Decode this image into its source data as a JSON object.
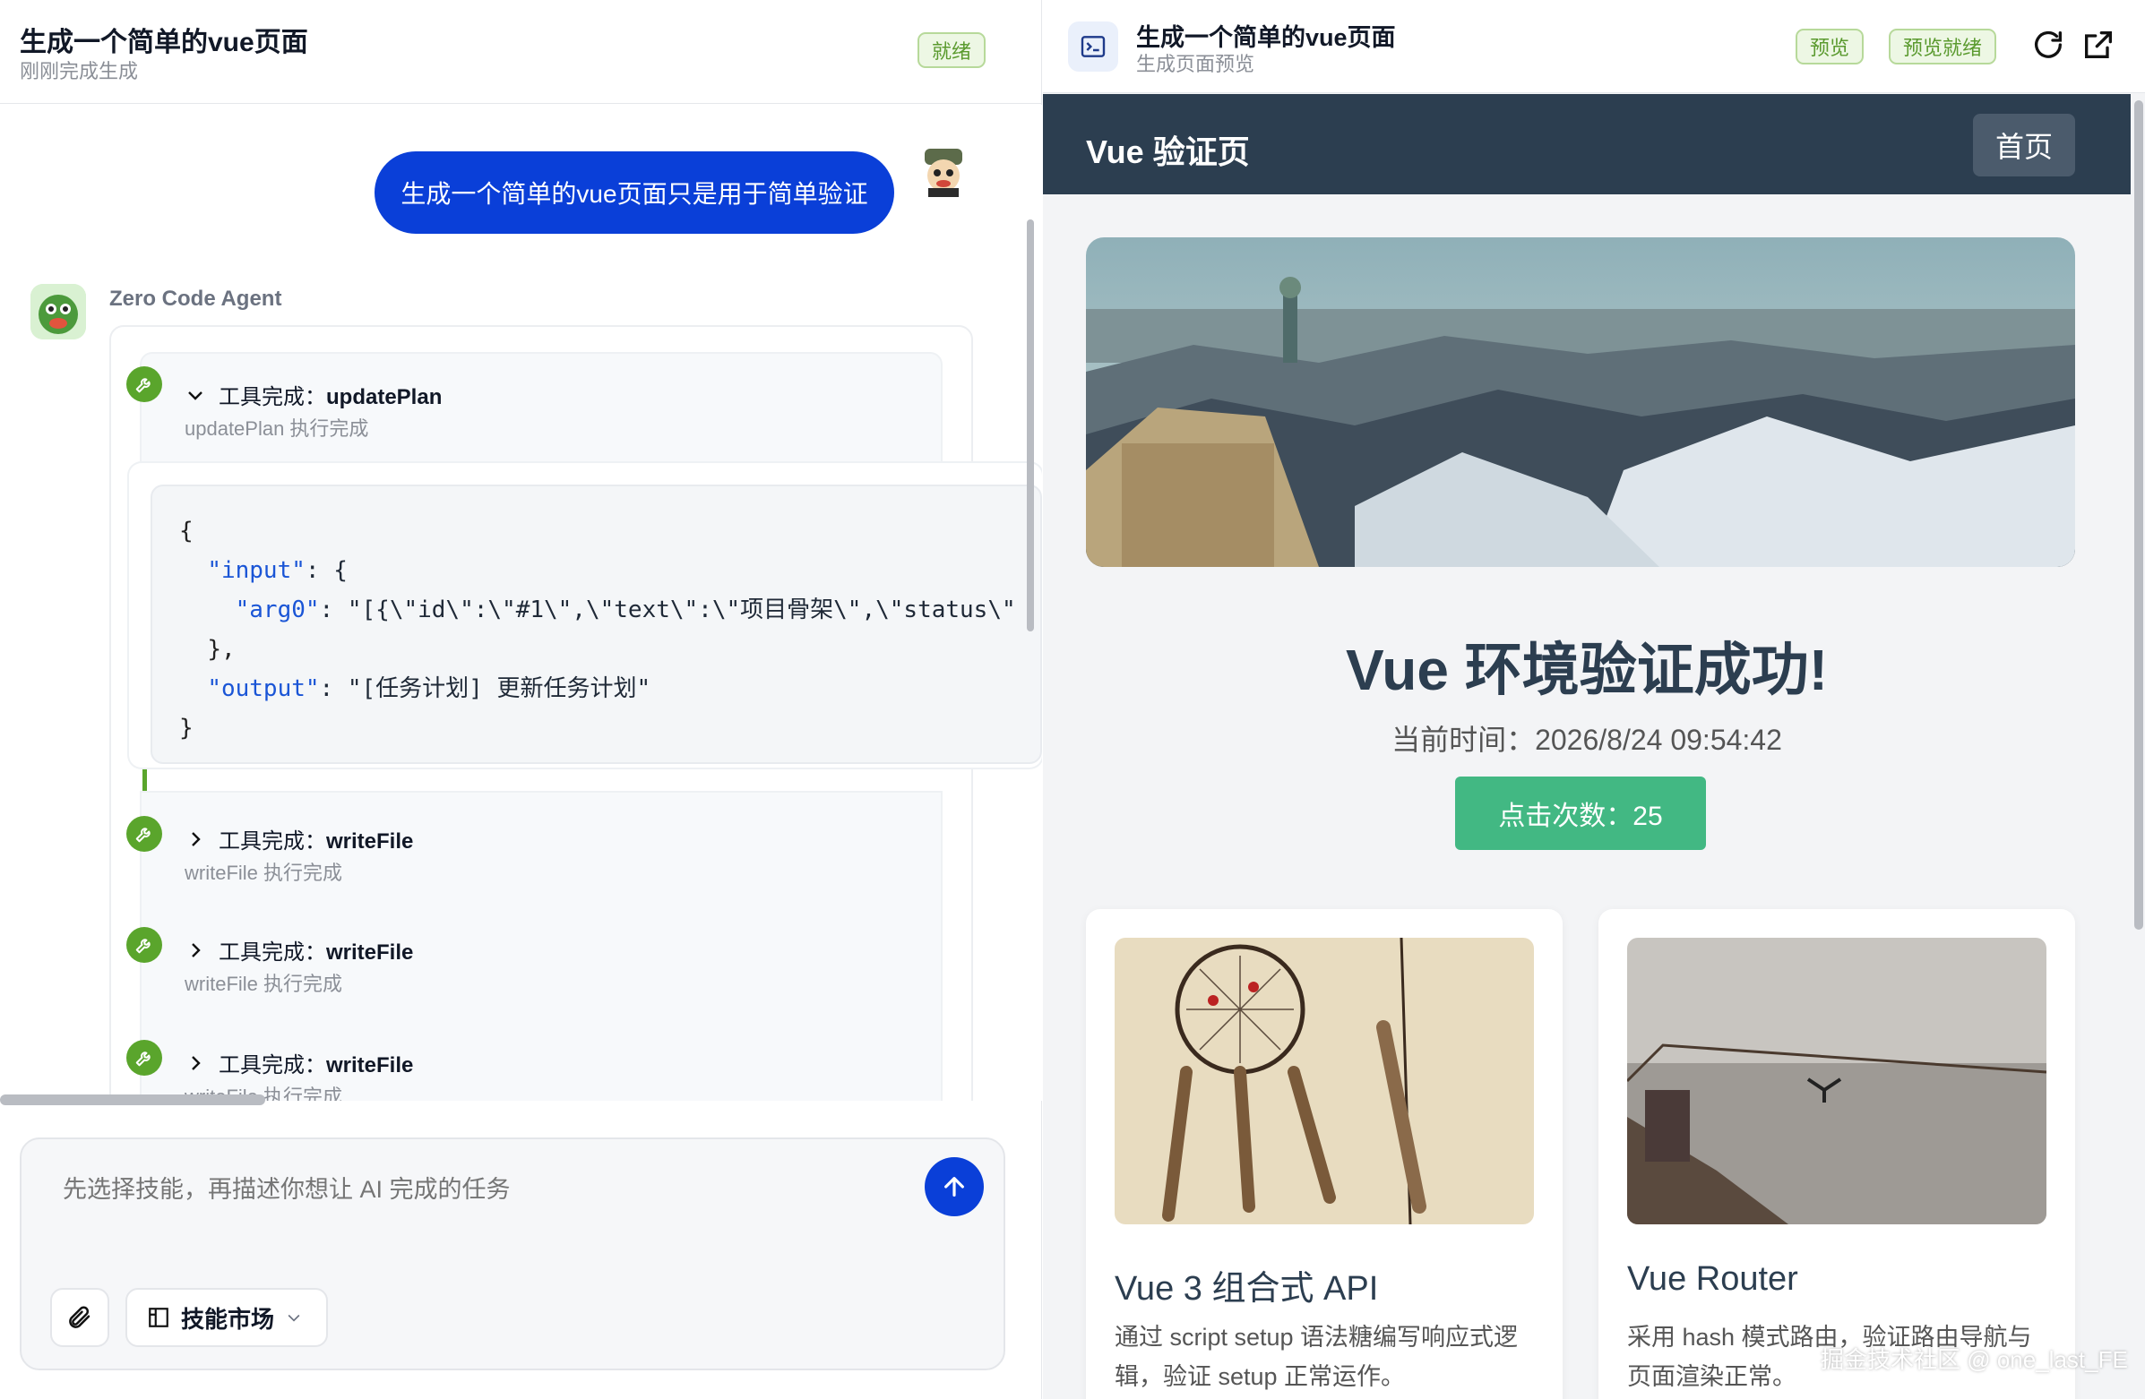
{
  "left_panel": {
    "title": "生成一个简单的vue页面",
    "subtitle": "刚刚完成生成",
    "status": "就绪"
  },
  "chat": {
    "user_message": "生成一个简单的vue页面只是用于简单验证",
    "agent_name": "Zero Code Agent",
    "tools": [
      {
        "prefix": "工具完成：",
        "name": "updatePlan",
        "subtitle": "updatePlan 执行完成",
        "expanded": true
      },
      {
        "prefix": "工具完成：",
        "name": "writeFile",
        "subtitle": "writeFile 执行完成",
        "expanded": false
      },
      {
        "prefix": "工具完成：",
        "name": "writeFile",
        "subtitle": "writeFile 执行完成",
        "expanded": false
      },
      {
        "prefix": "工具完成：",
        "name": "writeFile",
        "subtitle": "writeFile 执行完成",
        "expanded": false
      }
    ],
    "code": {
      "open": "{",
      "input_key": "\"input\"",
      "input_open": ": {",
      "arg_key": "\"arg0\"",
      "arg_value": ": \"[{\\\"id\\\":\\\"#1\\\",\\\"text\\\":\\\"项目骨架\\\",\\\"status\\\"",
      "input_close": "},",
      "output_key": "\"output\"",
      "output_value": ": \"[任务计划] 更新任务计划\"",
      "close": "}"
    }
  },
  "composer": {
    "placeholder": "先选择技能，再描述你想让 AI 完成的任务",
    "skill_market_label": "技能市场"
  },
  "right_panel": {
    "title": "生成一个简单的vue页面",
    "subtitle": "生成页面预览",
    "preview_badge": "预览",
    "ready_badge": "预览就绪"
  },
  "preview": {
    "brand": "Vue 验证页",
    "home_button": "首页",
    "heading": "Vue 环境验证成功!",
    "time_text": "当前时间：2026/8/24 09:54:42",
    "click_button": "点击次数：25",
    "cards": [
      {
        "title": "Vue 3 组合式 API",
        "desc": "通过 script setup 语法糖编写响应式逻辑，验证 setup 正常运作。"
      },
      {
        "title": "Vue Router",
        "desc": "采用 hash 模式路由，验证路由导航与页面渲染正常。"
      }
    ]
  },
  "watermark": "掘金技术社区 @ one_last_FE",
  "colors": {
    "primary_blue": "#0a3fd8",
    "success_green": "#5aa52c",
    "vue_green": "#42b883",
    "nav_dark": "#2c3e50"
  },
  "icons": {
    "tool": "wrench-icon",
    "send": "arrow-up-icon",
    "attach": "paperclip-icon",
    "skill": "grid-icon",
    "terminal": "terminal-icon",
    "refresh": "refresh-icon",
    "external": "external-link-icon"
  }
}
